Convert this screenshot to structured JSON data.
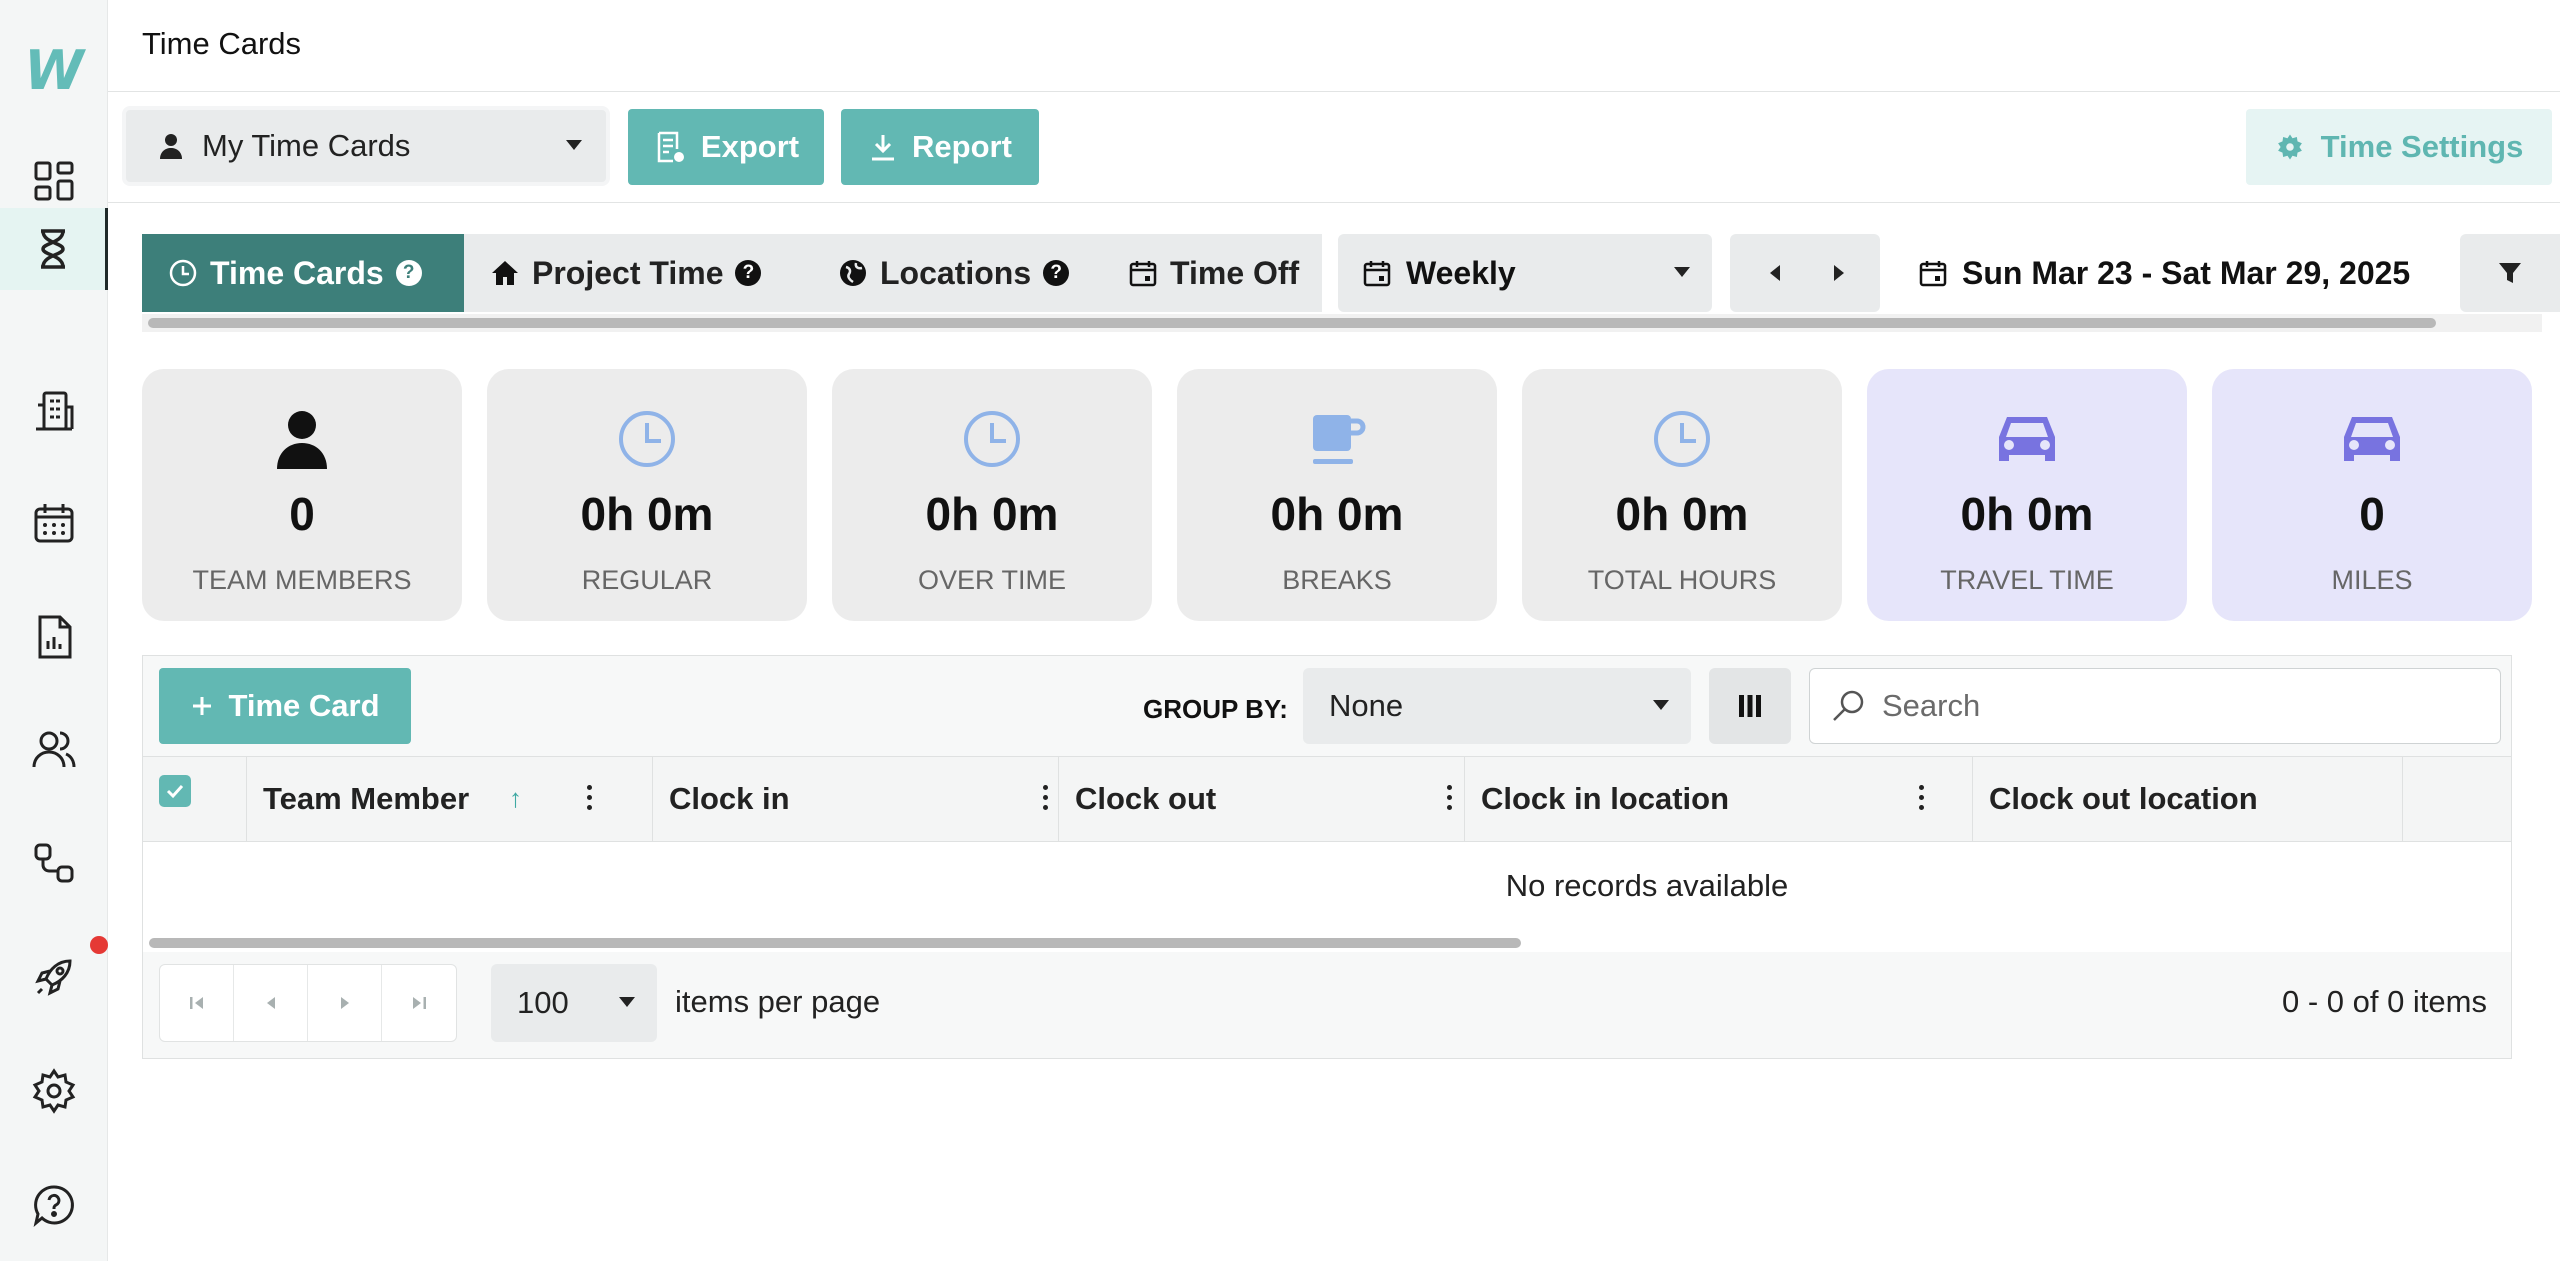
{
  "app": {
    "logo": "W",
    "page_title": "Time Cards"
  },
  "sidebar": {
    "items": [
      {
        "name": "dashboard",
        "icon": "dashboard-icon"
      },
      {
        "name": "time",
        "icon": "hourglass-icon",
        "active": true
      },
      {
        "name": "buildings",
        "icon": "building-icon"
      },
      {
        "name": "calendar",
        "icon": "calendar-icon"
      },
      {
        "name": "reports",
        "icon": "report-icon"
      },
      {
        "name": "team",
        "icon": "users-icon"
      },
      {
        "name": "workflow",
        "icon": "workflow-icon"
      },
      {
        "name": "launch",
        "icon": "rocket-icon",
        "notification": true
      },
      {
        "name": "settings",
        "icon": "gear-icon"
      },
      {
        "name": "help",
        "icon": "help-icon"
      }
    ]
  },
  "toolbar": {
    "view_select": "My Time Cards",
    "export_label": "Export",
    "report_label": "Report",
    "settings_label": "Time Settings"
  },
  "tabs": [
    {
      "label": "Time Cards",
      "help": "?",
      "active": true
    },
    {
      "label": "Project Time",
      "help": "?"
    },
    {
      "label": "Locations",
      "help": "?"
    },
    {
      "label": "Time Off"
    }
  ],
  "period": {
    "selected": "Weekly",
    "range": "Sun Mar 23 - Sat Mar 29, 2025"
  },
  "stats": [
    {
      "value": "0",
      "label": "TEAM MEMBERS",
      "icon": "person-icon"
    },
    {
      "value": "0h 0m",
      "label": "REGULAR",
      "icon": "clock-icon"
    },
    {
      "value": "0h 0m",
      "label": "OVER TIME",
      "icon": "clock-icon"
    },
    {
      "value": "0h 0m",
      "label": "BREAKS",
      "icon": "coffee-icon"
    },
    {
      "value": "0h 0m",
      "label": "TOTAL HOURS",
      "icon": "clock-icon"
    },
    {
      "value": "0h 0m",
      "label": "TRAVEL TIME",
      "icon": "car-icon"
    },
    {
      "value": "0",
      "label": "MILES",
      "icon": "car-icon"
    }
  ],
  "grid": {
    "add_label": "Time Card",
    "group_by_label": "GROUP BY:",
    "group_by_value": "None",
    "search_placeholder": "Search",
    "columns": [
      "Team Member",
      "Clock in",
      "Clock out",
      "Clock in location",
      "Clock out location"
    ],
    "empty_text": "No records available",
    "page_size": "100",
    "page_size_label": "items per page",
    "count_text": "0 - 0 of 0 items"
  },
  "colors": {
    "accent": "#62b8b3",
    "active_tab": "#3d7f7a",
    "icon_blue": "#8fb3e8",
    "icon_purple": "#7873e0"
  }
}
